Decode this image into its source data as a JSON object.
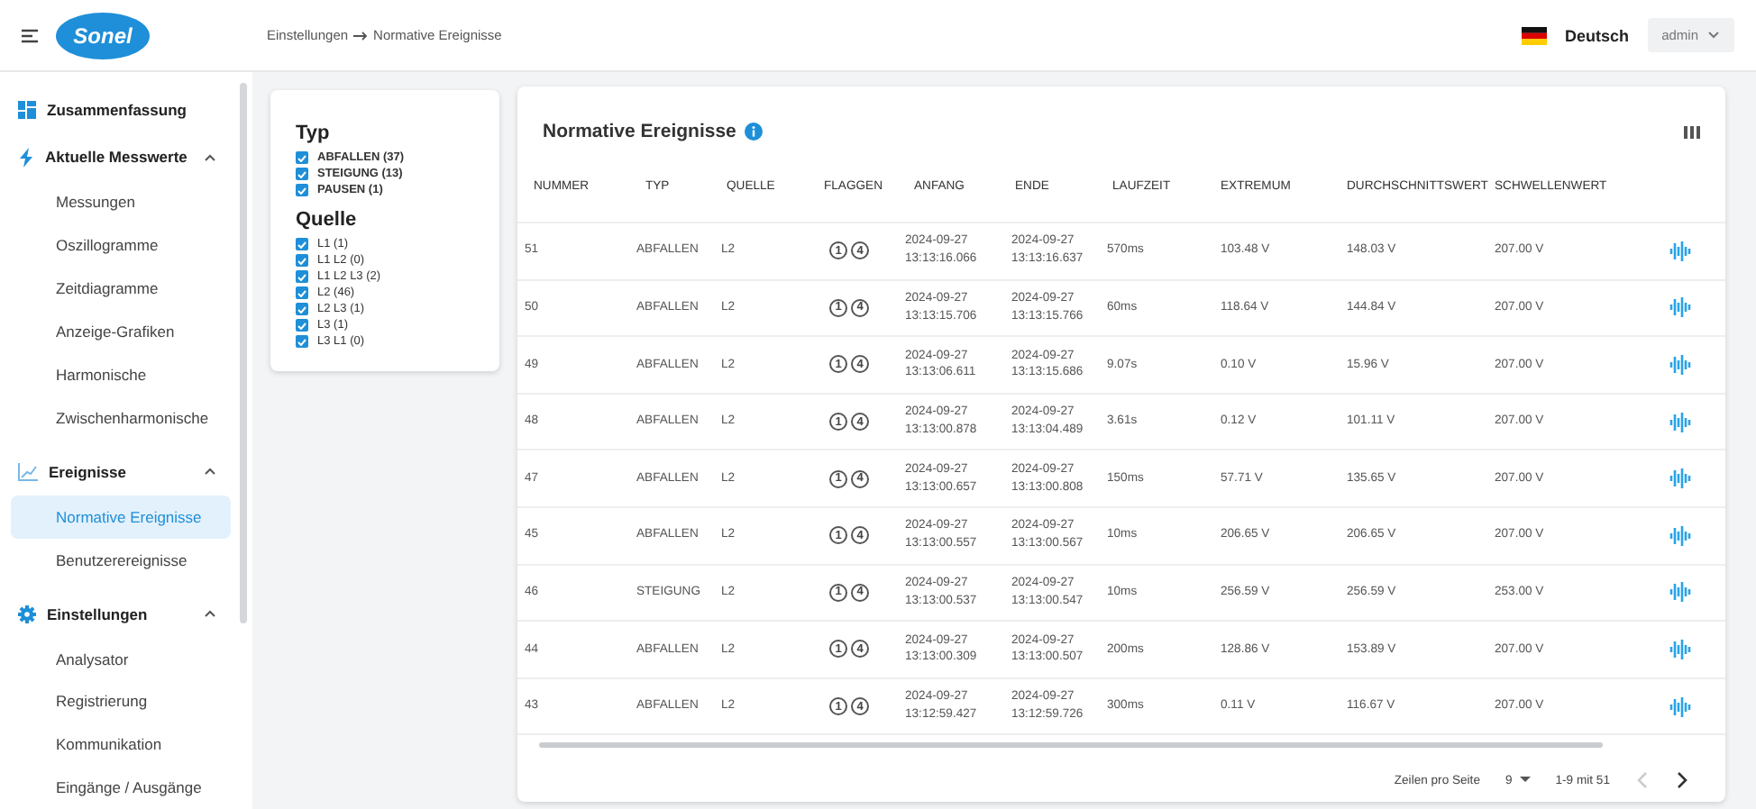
{
  "header": {
    "brand": "Sonel",
    "breadcrumb": [
      "Einstellungen",
      "Normative Ereignisse"
    ],
    "language": "Deutsch",
    "user": "admin"
  },
  "sidebar": {
    "items": [
      {
        "kind": "link",
        "label": "Zusammenfassung",
        "selected": false
      },
      {
        "kind": "group",
        "label": "Aktuelle Messwerte",
        "expanded": true,
        "children": [
          {
            "label": "Messungen",
            "selected": false
          },
          {
            "label": "Oszillogramme",
            "selected": false
          },
          {
            "label": "Zeitdiagramme",
            "selected": false
          },
          {
            "label": "Anzeige-Grafiken",
            "selected": false
          },
          {
            "label": "Harmonische",
            "selected": false
          },
          {
            "label": "Zwischenharmonische",
            "selected": false
          }
        ]
      },
      {
        "kind": "group",
        "label": "Ereignisse",
        "expanded": true,
        "children": [
          {
            "label": "Normative Ereignisse",
            "selected": true
          },
          {
            "label": "Benutzerereignisse",
            "selected": false
          }
        ]
      },
      {
        "kind": "group",
        "label": "Einstellungen",
        "expanded": true,
        "children": [
          {
            "label": "Analysator",
            "selected": false
          },
          {
            "label": "Registrierung",
            "selected": false
          },
          {
            "label": "Kommunikation",
            "selected": false
          },
          {
            "label": "Eingänge / Ausgänge",
            "selected": false
          }
        ]
      }
    ]
  },
  "filters": [
    {
      "title": "Typ",
      "options": [
        {
          "label": "ABFALLEN (37)",
          "checked": true
        },
        {
          "label": "STEIGUNG (13)",
          "checked": true
        },
        {
          "label": "PAUSEN (1)",
          "checked": true
        }
      ]
    },
    {
      "title": "Quelle",
      "options": [
        {
          "label": "L1 (1)",
          "checked": true
        },
        {
          "label": "L1 L2 (0)",
          "checked": true
        },
        {
          "label": "L1 L2 L3 (2)",
          "checked": true
        },
        {
          "label": "L2 (46)",
          "checked": true
        },
        {
          "label": "L2 L3 (1)",
          "checked": true
        },
        {
          "label": "L3 (1)",
          "checked": true
        },
        {
          "label": "L3 L1 (0)",
          "checked": true
        }
      ]
    }
  ],
  "table": {
    "title": "Normative Ereignisse",
    "columns": [
      "NUMMER",
      "TYP",
      "QUELLE",
      "FLAGGEN",
      "ANFANG",
      "ENDE",
      "LAUFZEIT",
      "EXTREMUM",
      "DURCHSCHNITTSWERT",
      "SCHWELLENWERT"
    ],
    "rows": [
      {
        "number": "51",
        "type": "ABFALLEN",
        "source": "L2",
        "flags": [
          "1",
          "4"
        ],
        "start": [
          "2024-09-27",
          "13:13:16.066"
        ],
        "end": [
          "2024-09-27",
          "13:13:16.637"
        ],
        "duration": "570ms",
        "extremum": "103.48 V",
        "average": "148.03 V",
        "threshold": "207.00 V"
      },
      {
        "number": "50",
        "type": "ABFALLEN",
        "source": "L2",
        "flags": [
          "1",
          "4"
        ],
        "start": [
          "2024-09-27",
          "13:13:15.706"
        ],
        "end": [
          "2024-09-27",
          "13:13:15.766"
        ],
        "duration": "60ms",
        "extremum": "118.64 V",
        "average": "144.84 V",
        "threshold": "207.00 V"
      },
      {
        "number": "49",
        "type": "ABFALLEN",
        "source": "L2",
        "flags": [
          "1",
          "4"
        ],
        "start": [
          "2024-09-27",
          "13:13:06.611"
        ],
        "end": [
          "2024-09-27",
          "13:13:15.686"
        ],
        "duration": "9.07s",
        "extremum": "0.10 V",
        "average": "15.96 V",
        "threshold": "207.00 V"
      },
      {
        "number": "48",
        "type": "ABFALLEN",
        "source": "L2",
        "flags": [
          "1",
          "4"
        ],
        "start": [
          "2024-09-27",
          "13:13:00.878"
        ],
        "end": [
          "2024-09-27",
          "13:13:04.489"
        ],
        "duration": "3.61s",
        "extremum": "0.12 V",
        "average": "101.11 V",
        "threshold": "207.00 V"
      },
      {
        "number": "47",
        "type": "ABFALLEN",
        "source": "L2",
        "flags": [
          "1",
          "4"
        ],
        "start": [
          "2024-09-27",
          "13:13:00.657"
        ],
        "end": [
          "2024-09-27",
          "13:13:00.808"
        ],
        "duration": "150ms",
        "extremum": "57.71 V",
        "average": "135.65 V",
        "threshold": "207.00 V"
      },
      {
        "number": "45",
        "type": "ABFALLEN",
        "source": "L2",
        "flags": [
          "1",
          "4"
        ],
        "start": [
          "2024-09-27",
          "13:13:00.557"
        ],
        "end": [
          "2024-09-27",
          "13:13:00.567"
        ],
        "duration": "10ms",
        "extremum": "206.65 V",
        "average": "206.65 V",
        "threshold": "207.00 V"
      },
      {
        "number": "46",
        "type": "STEIGUNG",
        "source": "L2",
        "flags": [
          "1",
          "4"
        ],
        "start": [
          "2024-09-27",
          "13:13:00.537"
        ],
        "end": [
          "2024-09-27",
          "13:13:00.547"
        ],
        "duration": "10ms",
        "extremum": "256.59 V",
        "average": "256.59 V",
        "threshold": "253.00 V"
      },
      {
        "number": "44",
        "type": "ABFALLEN",
        "source": "L2",
        "flags": [
          "1",
          "4"
        ],
        "start": [
          "2024-09-27",
          "13:13:00.309"
        ],
        "end": [
          "2024-09-27",
          "13:13:00.507"
        ],
        "duration": "200ms",
        "extremum": "128.86 V",
        "average": "153.89 V",
        "threshold": "207.00 V"
      },
      {
        "number": "43",
        "type": "ABFALLEN",
        "source": "L2",
        "flags": [
          "1",
          "4"
        ],
        "start": [
          "2024-09-27",
          "13:12:59.427"
        ],
        "end": [
          "2024-09-27",
          "13:12:59.726"
        ],
        "duration": "300ms",
        "extremum": "0.11 V",
        "average": "116.67 V",
        "threshold": "207.00 V"
      }
    ]
  },
  "pagination": {
    "rows_label": "Zeilen pro Seite",
    "rows_per_page": "9",
    "range": "1-9 mit 51",
    "prev": {
      "disabled": true
    },
    "next": {
      "disabled": false
    }
  }
}
